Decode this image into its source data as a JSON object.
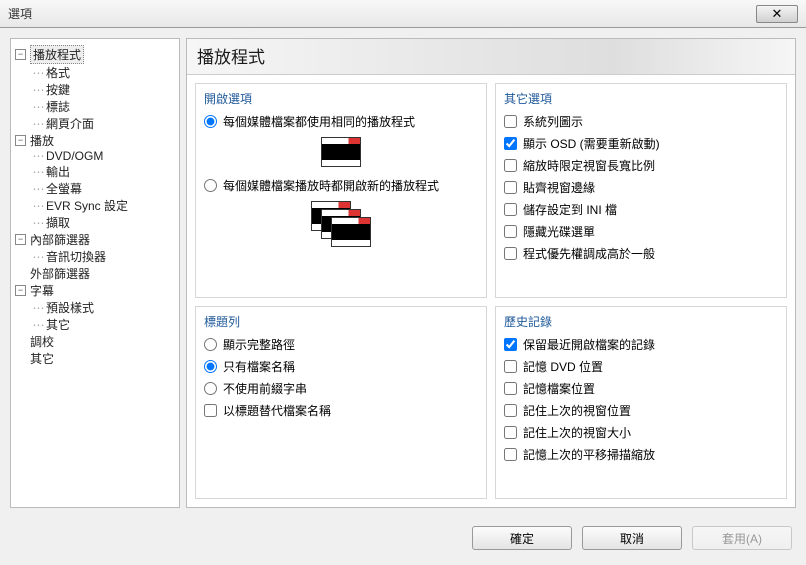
{
  "window_title": "選項",
  "close_glyph": "✕",
  "tree": {
    "player": {
      "label": "播放程式",
      "children": {
        "formats": "格式",
        "keys": "按鍵",
        "logo": "標誌",
        "webif": "網頁介面"
      }
    },
    "playback": {
      "label": "播放",
      "children": {
        "dvdogm": "DVD/OGM",
        "output": "輸出",
        "fullscreen": "全螢幕",
        "evrsync": "EVR Sync 設定",
        "capture": "擷取"
      }
    },
    "internal_filters": {
      "label": "內部篩選器",
      "children": {
        "audioswitcher": "音訊切換器"
      }
    },
    "external_filters": "外部篩選器",
    "subtitles": {
      "label": "字幕",
      "children": {
        "defaultstyle": "預設樣式",
        "misc": "其它"
      }
    },
    "tweaks": "調校",
    "other": "其它"
  },
  "page_title": "播放程式",
  "groups": {
    "open": {
      "title": "開啟選項",
      "opt_same_player": "每個媒體檔案都使用相同的播放程式",
      "opt_new_player": "每個媒體檔案播放時都開啟新的播放程式"
    },
    "other": {
      "title": "其它選項",
      "tray": "系統列圖示",
      "osd": "顯示 OSD (需要重新啟動)",
      "limit_ar": "縮放時限定視窗長寬比例",
      "snap": "貼齊視窗邊緣",
      "ini": "儲存設定到 INI 檔",
      "hidecd": "隱藏光碟選單",
      "priority": "程式優先權調成高於一般"
    },
    "titlebar": {
      "title": "標題列",
      "fullpath": "顯示完整路徑",
      "nameonly": "只有檔案名稱",
      "noprefix": "不使用前綴字串",
      "replace": "以標題替代檔案名稱"
    },
    "history": {
      "title": "歷史記錄",
      "recent": "保留最近開啟檔案的記錄",
      "dvdpos": "記憶 DVD 位置",
      "filepos": "記憶檔案位置",
      "winpos": "記住上次的視窗位置",
      "winsize": "記住上次的視窗大小",
      "pnspos": "記憶上次的平移掃描縮放"
    }
  },
  "buttons": {
    "ok": "確定",
    "cancel": "取消",
    "apply": "套用(A)"
  }
}
